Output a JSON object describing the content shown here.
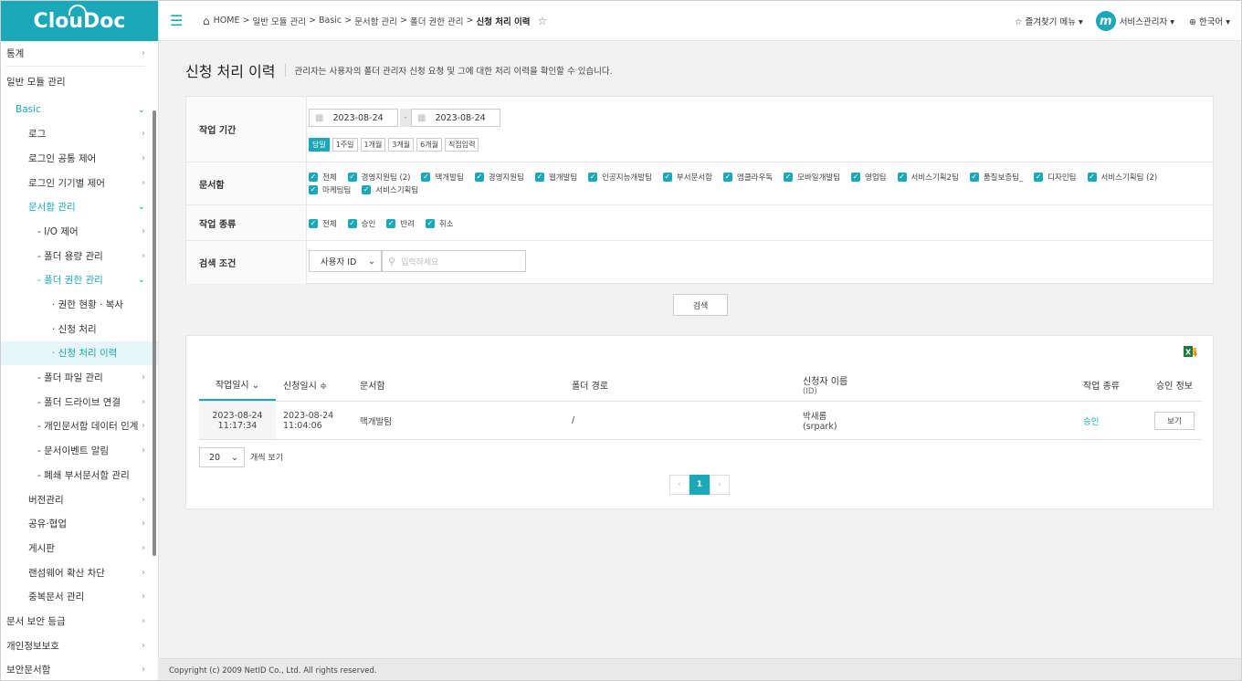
{
  "app": {
    "logo": "ClouDoc"
  },
  "sidebar": {
    "top_item": "통계",
    "section_title": "일반 모듈 관리",
    "items": [
      {
        "label": "Basic",
        "chev": "⌄"
      },
      {
        "label": "로그",
        "chev": "›"
      },
      {
        "label": "로그인 공통 제어",
        "chev": "›"
      },
      {
        "label": "로그인 기기별 제어",
        "chev": "›"
      },
      {
        "label": "문서함 관리",
        "chev": "⌄"
      },
      {
        "label": "- I/O 제어",
        "chev": "›"
      },
      {
        "label": "- 폴더 용량 관리",
        "chev": "›"
      },
      {
        "label": "- 폴더 권한 관리",
        "chev": "⌄"
      },
      {
        "label": "· 권한 현황 · 복사",
        "chev": ""
      },
      {
        "label": "· 신청 처리",
        "chev": ""
      },
      {
        "label": "· 신청 처리 이력",
        "chev": ""
      },
      {
        "label": "- 폴더 파일 관리",
        "chev": "›"
      },
      {
        "label": "- 폴더 드라이브 연결",
        "chev": "›"
      },
      {
        "label": "- 개인문서함 데이터 인계",
        "chev": "›"
      },
      {
        "label": "- 문서이벤트 알림",
        "chev": "›"
      },
      {
        "label": "- 폐쇄 부서문서함 관리",
        "chev": ""
      },
      {
        "label": "버전관리",
        "chev": "›"
      },
      {
        "label": "공유·협업",
        "chev": "›"
      },
      {
        "label": "게시판",
        "chev": "›"
      },
      {
        "label": "랜섬웨어 확산 차단",
        "chev": "›"
      },
      {
        "label": "중복문서 관리",
        "chev": "›"
      },
      {
        "label": "문서 보안 등급",
        "chev": "›"
      },
      {
        "label": "개인정보보호",
        "chev": "›"
      },
      {
        "label": "보안문서함",
        "chev": "›"
      }
    ]
  },
  "topbar": {
    "breadcrumb": [
      "HOME",
      ">",
      "일반 모듈 관리",
      ">",
      "Basic",
      ">",
      "문서함 관리",
      ">",
      "폴더 권한 관리",
      ">"
    ],
    "current": "신청 처리 이력",
    "favorites": "☆ 즐겨찾기 메뉴 ▾",
    "avatar_letter": "m",
    "user": "서비스관리자 ▾",
    "language": "⊕ 한국어 ▾"
  },
  "page": {
    "title": "신청 처리 이력",
    "description": "관리자는 사용자의 폴더 관리자 신청 요청 및 그에 대한 처리 이력을 확인할 수 있습니다."
  },
  "filter": {
    "period_label": "작업 기간",
    "date_from": "2023-08-24",
    "date_to": "2023-08-24",
    "date_dash": "-",
    "period_buttons": [
      "당일",
      "1주일",
      "1개월",
      "3개월",
      "6개월",
      "직접입력"
    ],
    "docbox_label": "문서함",
    "docboxes": [
      "전체",
      "경영지원팀 (2)",
      "맥개발팀",
      "경영지원팀",
      "웹개발팀",
      "인공지능개발팀",
      "부서문서함",
      "엠클라우독",
      "모바일개발팀",
      "영업팀",
      "서비스기획2팀",
      "품질보증팀_",
      "디자인팀",
      "서비스기획팀 (2)",
      "마케팅팀",
      "서비스기획팀"
    ],
    "type_label": "작업 종류",
    "types": [
      "전체",
      "승인",
      "반려",
      "취소"
    ],
    "search_label": "검색 조건",
    "search_select": "사용자 ID",
    "search_placeholder": "입력하세요",
    "search_button": "검색"
  },
  "table": {
    "headers": {
      "work_date": "작업일시 ⌄",
      "request_date": "신청일시 ≑",
      "docbox": "문서함",
      "path": "폴더 경로",
      "requester": "신청자 이름",
      "requester_sub": "(ID)",
      "type": "작업 종류",
      "approval": "승인 정보"
    },
    "rows": [
      {
        "work_date": "2023-08-24",
        "work_time": "11:17:34",
        "request_date": "2023-08-24",
        "request_time": "11:04:06",
        "docbox": "맥개발팀",
        "path": "/",
        "requester_name": "박새롬",
        "requester_id": "(srpark)",
        "type": "승인",
        "view_label": "보기"
      }
    ],
    "page_size": "20",
    "page_size_label": "개씩 보기",
    "pagination": {
      "prev": "‹",
      "current": "1",
      "next": "›"
    }
  },
  "colors": {
    "accent": "#1ba8b8",
    "excel": "#1d7a3e"
  },
  "footer": {
    "copyright": "Copyright (c) 2009 NetID Co., Ltd. All rights reserved."
  }
}
